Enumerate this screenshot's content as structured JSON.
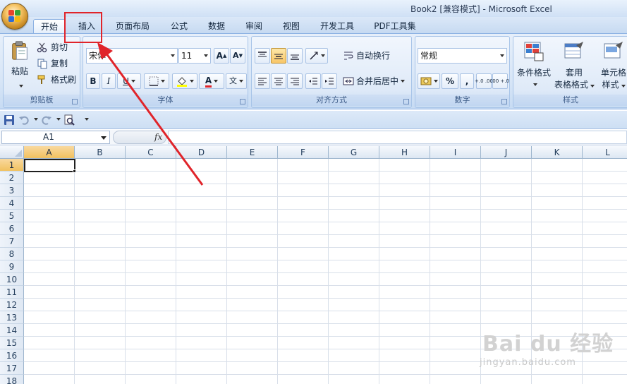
{
  "window": {
    "title": "Book2  [兼容模式] - Microsoft Excel"
  },
  "tabs": [
    "开始",
    "插入",
    "页面布局",
    "公式",
    "数据",
    "审阅",
    "视图",
    "开发工具",
    "PDF工具集"
  ],
  "clipboard": {
    "paste": "粘贴",
    "cut": "剪切",
    "copy": "复制",
    "format_painter": "格式刷",
    "label": "剪贴板"
  },
  "font": {
    "name": "宋体",
    "size": "11",
    "bold": "B",
    "italic": "I",
    "underline": "U",
    "font_color": "A",
    "label": "字体",
    "phonetic": "文"
  },
  "alignment": {
    "wrap_text": "自动换行",
    "merge_center": "合并后居中",
    "label": "对齐方式"
  },
  "number": {
    "format": "常规",
    "percent": "%",
    "comma": ",",
    "inc_decimal": "+.0 .00",
    "dec_decimal": ".00 +.0",
    "label": "数字"
  },
  "styles": {
    "conditional": "条件格式",
    "table_format_1": "套用",
    "table_format_2": "表格格式",
    "cell_styles_1": "单元格",
    "cell_styles_2": "样式",
    "label": "样式"
  },
  "formula_bar": {
    "name_box": "A1",
    "fx": "fx",
    "value": ""
  },
  "grid": {
    "columns": [
      "A",
      "B",
      "C",
      "D",
      "E",
      "F",
      "G",
      "H",
      "I",
      "J",
      "K",
      "L"
    ],
    "rows": [
      "1",
      "2",
      "3",
      "4",
      "5",
      "6",
      "7",
      "8",
      "9",
      "10",
      "11",
      "12",
      "13",
      "14",
      "15",
      "16",
      "17",
      "18"
    ],
    "selected_cell": "A1"
  },
  "watermark": {
    "main": "Bai du 经验",
    "sub": "jingyan.baidu.com"
  },
  "colors": {
    "accent": "#e0242a",
    "ribbon": "#dfeaf8",
    "selected_header": "#f1c15f"
  }
}
